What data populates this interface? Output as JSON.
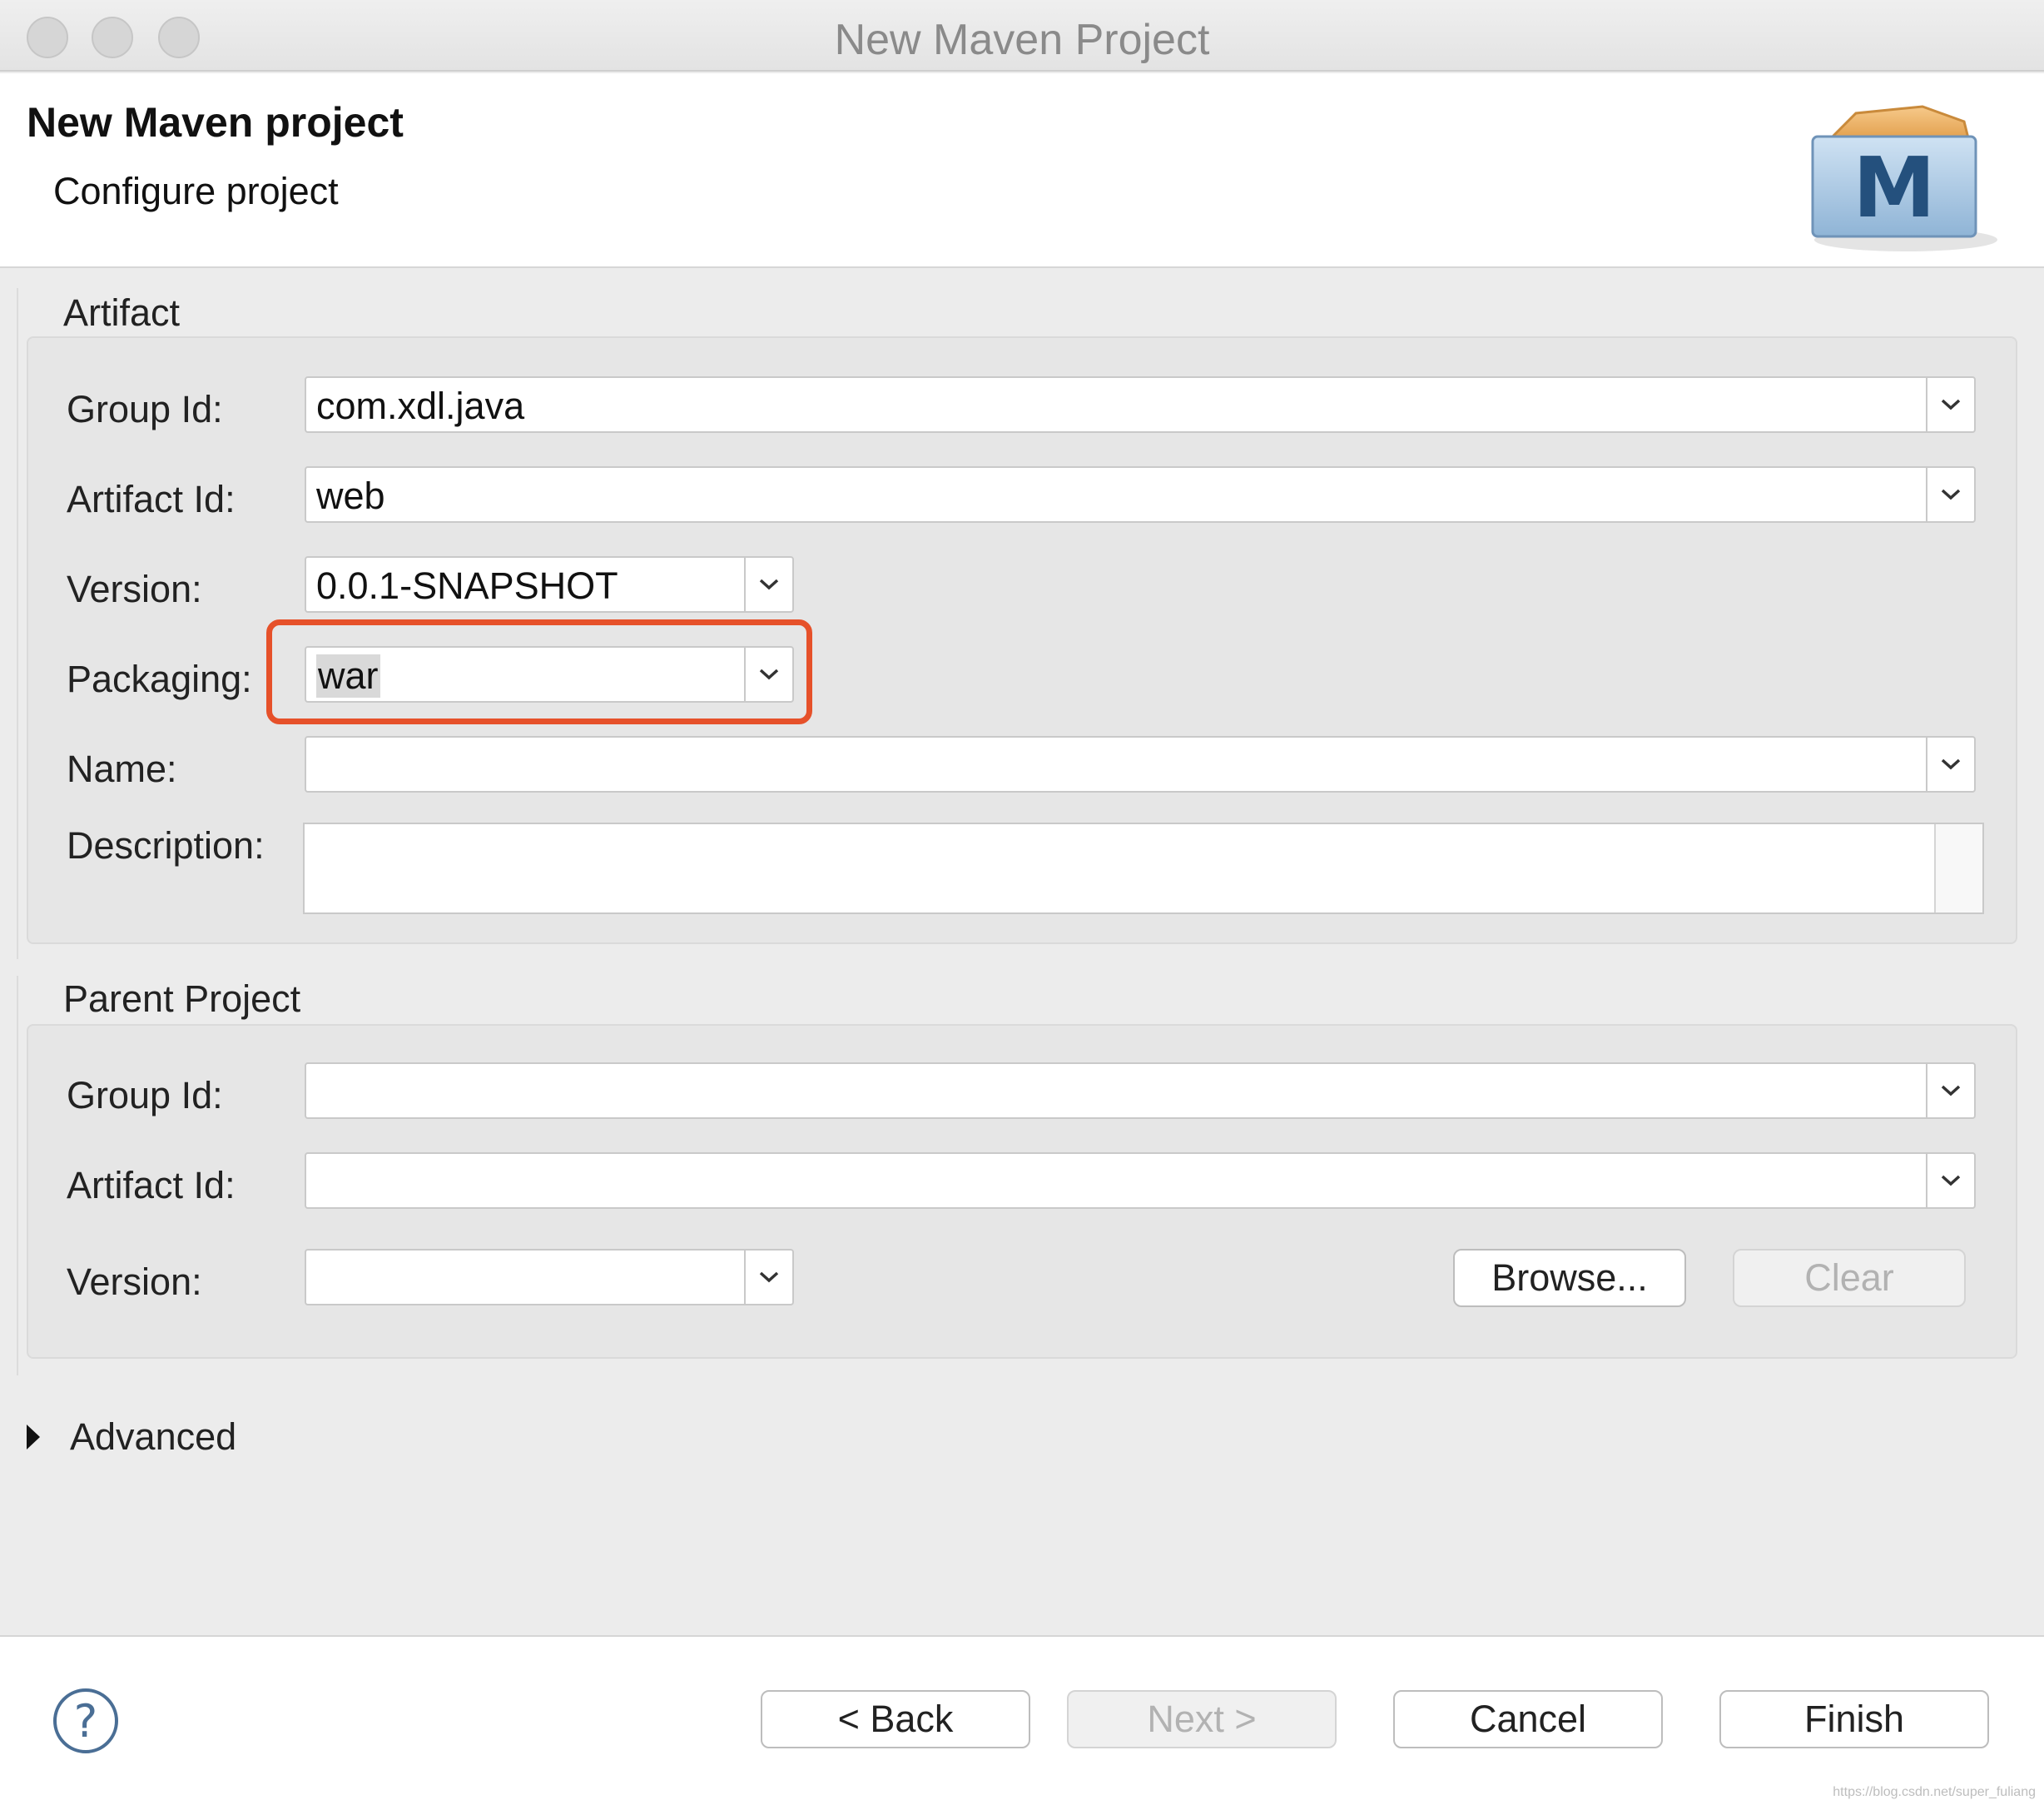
{
  "window": {
    "title": "New Maven Project",
    "traffic_lights": [
      "close",
      "minimize",
      "zoom"
    ]
  },
  "header": {
    "title": "New Maven project",
    "subtitle": "Configure project",
    "logo_letter": "M"
  },
  "artifact": {
    "group_label": "Artifact",
    "group_id_label": "Group Id:",
    "group_id_value": "com.xdl.java",
    "artifact_id_label": "Artifact Id:",
    "artifact_id_value": "web",
    "version_label": "Version:",
    "version_value": "0.0.1-SNAPSHOT",
    "packaging_label": "Packaging:",
    "packaging_value": "war",
    "name_label": "Name:",
    "name_value": "",
    "description_label": "Description:",
    "description_value": ""
  },
  "parent": {
    "group_label": "Parent Project",
    "group_id_label": "Group Id:",
    "group_id_value": "",
    "artifact_id_label": "Artifact Id:",
    "artifact_id_value": "",
    "version_label": "Version:",
    "version_value": "",
    "browse_label": "Browse...",
    "clear_label": "Clear"
  },
  "advanced": {
    "label": "Advanced",
    "expanded": false
  },
  "footer": {
    "help_glyph": "?",
    "back_label": "< Back",
    "next_label": "Next >",
    "cancel_label": "Cancel",
    "finish_label": "Finish",
    "watermark": "https://blog.csdn.net/super_fuliang"
  },
  "colors": {
    "highlight": "#e6512a",
    "panel": "#e6e6e6",
    "disabled_text": "#b2b2b2"
  },
  "icons": [
    "chevron-down-icon",
    "disclosure-triangle-icon",
    "help-icon",
    "maven-logo-icon"
  ]
}
